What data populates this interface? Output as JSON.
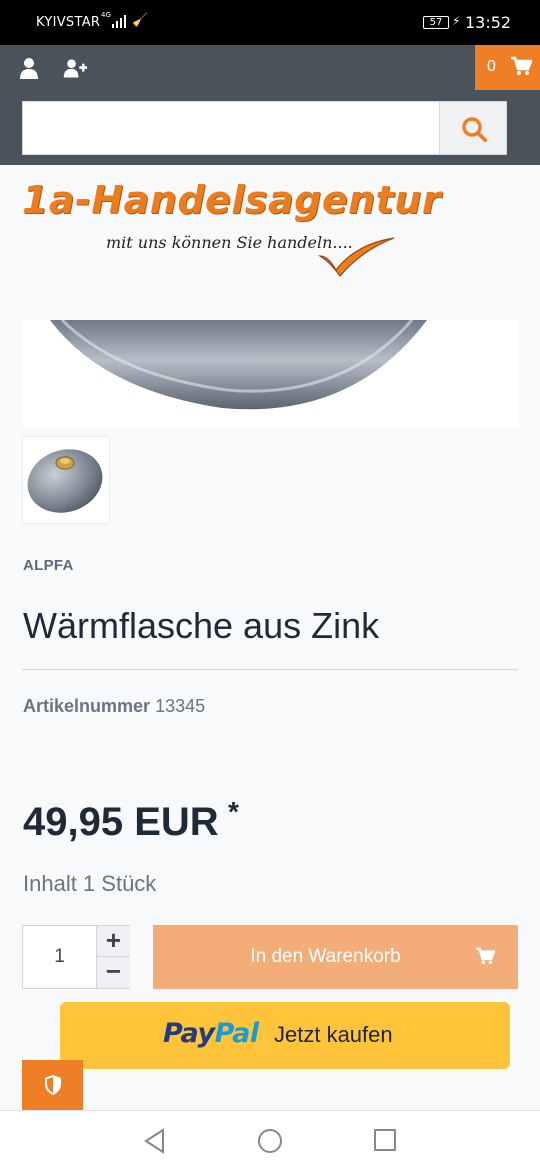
{
  "status_bar": {
    "carrier": "KYIVSTAR",
    "network": "4G",
    "battery": "57",
    "time": "13:52"
  },
  "header": {
    "cart_count": "0",
    "search": {
      "placeholder": "",
      "value": ""
    }
  },
  "logo": {
    "brand": "1a-Handelsagentur",
    "tagline": "mit uns können Sie handeln...."
  },
  "product": {
    "manufacturer": "ALPFA",
    "title": "Wärmflasche aus Zink",
    "sku_label": "Artikelnummer",
    "sku_value": "13345",
    "price": "49,95 EUR",
    "price_note": "*",
    "unit": "Inhalt 1 Stück",
    "quantity": "1",
    "qty_plus": "+",
    "qty_minus": "−",
    "add_to_cart": "In den Warenkorb"
  },
  "paypal": {
    "brand_a": "Pay",
    "brand_b": "Pal",
    "label": "Jetzt kaufen"
  },
  "colors": {
    "accent": "#ef7f27",
    "header": "#4a525a",
    "cart_button": "#f2ad78",
    "paypal": "#ffc439"
  },
  "icons": [
    "user-icon",
    "add-user-icon",
    "cart-icon",
    "search-icon",
    "shield-icon",
    "back-icon",
    "home-icon",
    "recents-icon"
  ]
}
